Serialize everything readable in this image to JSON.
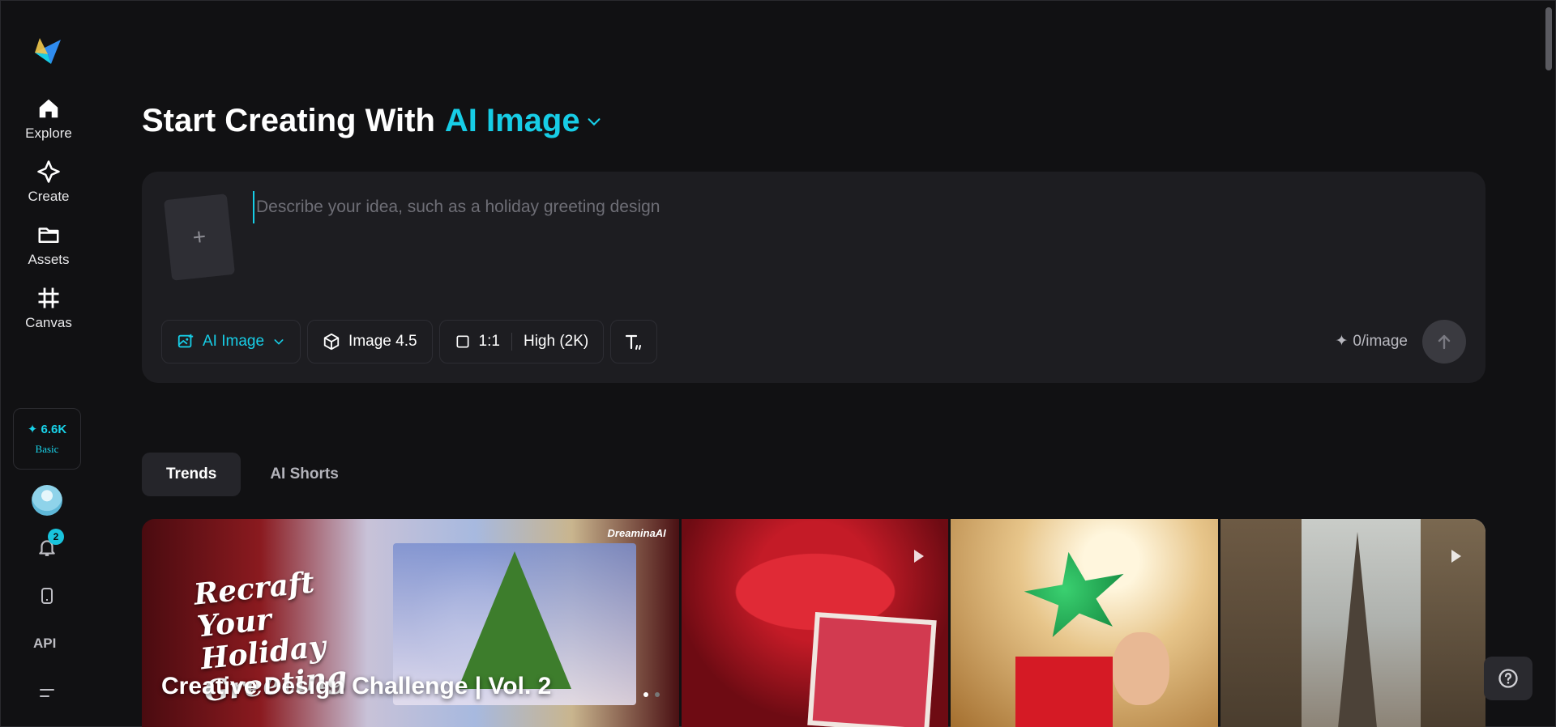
{
  "sidebar": {
    "nav": [
      {
        "label": "Explore",
        "icon": "home-icon"
      },
      {
        "label": "Create",
        "icon": "sparkle-icon"
      },
      {
        "label": "Assets",
        "icon": "folder-icon"
      },
      {
        "label": "Canvas",
        "icon": "canvas-icon"
      }
    ],
    "credits": {
      "amount": "6.6K",
      "plan": "Basic"
    },
    "notifications_count": "2",
    "api_label": "API"
  },
  "headline": {
    "prefix": "Start Creating With",
    "mode": "AI Image"
  },
  "prompt": {
    "placeholder": "Describe your idea, such as a holiday greeting design",
    "upload_symbol": "+"
  },
  "toolbar": {
    "mode_label": "AI Image",
    "model_label": "Image 4.5",
    "ratio_label": "1:1",
    "quality_label": "High (2K)",
    "cost_label": "0/image"
  },
  "tabs": [
    {
      "label": "Trends",
      "active": true
    },
    {
      "label": "AI Shorts",
      "active": false
    }
  ],
  "gallery": {
    "hero": {
      "script_text": "Recraft Your Holiday Greeting",
      "brand": "DreaminaAI",
      "title": "Creative Design Challenge | Vol. 2"
    }
  },
  "colors": {
    "accent": "#17cde6",
    "bg": "#111113",
    "panel": "#1d1d21"
  }
}
